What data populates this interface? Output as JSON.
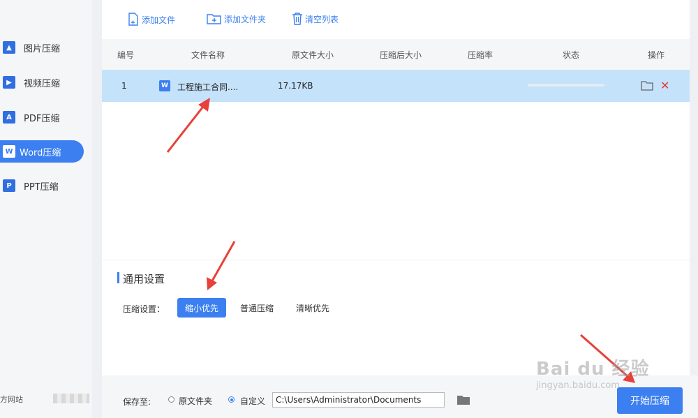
{
  "sidebar": {
    "items": [
      {
        "label": "图片压缩",
        "icon": "image-compress-icon",
        "active": false
      },
      {
        "label": "视频压缩",
        "icon": "video-compress-icon",
        "active": false
      },
      {
        "label": "PDF压缩",
        "icon": "pdf-compress-icon",
        "active": false
      },
      {
        "label": "Word压缩",
        "icon": "word-compress-icon",
        "active": true
      },
      {
        "label": "PPT压缩",
        "icon": "ppt-compress-icon",
        "active": false
      }
    ],
    "footer_link": "方网站"
  },
  "toolbar": {
    "add_file": "添加文件",
    "add_folder": "添加文件夹",
    "clear_list": "清空列表"
  },
  "table": {
    "headers": [
      "编号",
      "文件名称",
      "原文件大小",
      "压缩后大小",
      "压缩率",
      "状态",
      "操作"
    ],
    "rows": [
      {
        "index": "1",
        "file_icon": "W",
        "name": "工程施工合同....",
        "original_size": "17.17KB",
        "compressed_size": "",
        "rate": "",
        "status_progress": 0
      }
    ]
  },
  "settings": {
    "title": "通用设置",
    "compress_label": "压缩设置：",
    "options": [
      "缩小优先",
      "普通压缩",
      "清晰优先"
    ],
    "selected": "缩小优先"
  },
  "footer": {
    "save_label": "保存至:",
    "radio_original": "原文件夹",
    "radio_custom": "自定义",
    "selected_radio": "自定义",
    "path_value": "C:\\Users\\Administrator\\Documents",
    "start_label": "开始压缩"
  },
  "watermark": {
    "main": "Bai du 经验",
    "sub": "jingyan.baidu.com"
  },
  "colors": {
    "accent": "#3b7ff0",
    "row_highlight": "#c5e2fb",
    "delete": "#e53935",
    "annotation_arrow": "#e8403a"
  }
}
